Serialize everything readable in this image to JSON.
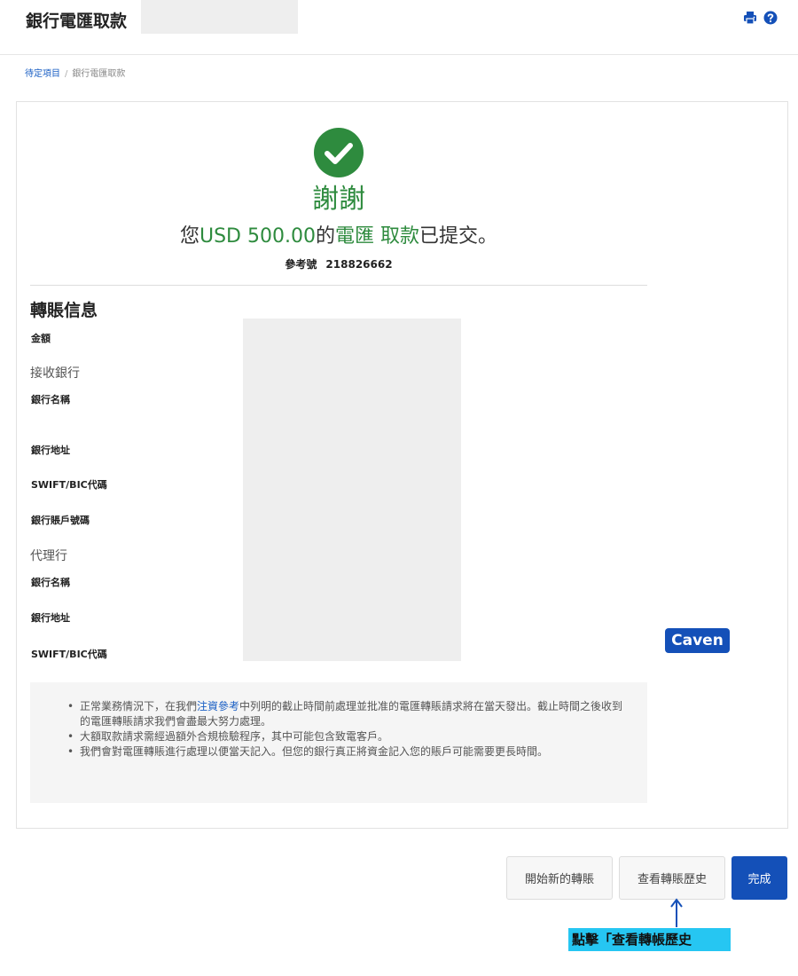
{
  "header": {
    "title": "銀行電匯取款",
    "print_icon": "print-icon",
    "help_icon": "help-icon"
  },
  "breadcrumb": {
    "parent": "待定項目",
    "separator": "/",
    "current": "銀行電匯取款"
  },
  "confirmation": {
    "icon": "checkmark-circle-icon",
    "thanks": "謝謝",
    "prefix": "您",
    "amount": "USD 500.00",
    "middle": "的",
    "type1": "電匯",
    "type2": "取款",
    "suffix": "已提交。",
    "ref_label": "參考號",
    "ref_number": "218826662"
  },
  "transfer_info": {
    "title": "轉賬信息",
    "amount_label": "金額",
    "receiving_bank_heading": "接收銀行",
    "bank_name_label": "銀行名稱",
    "bank_address_label": "銀行地址",
    "swift_label": "SWIFT/BIC代碼",
    "account_label": "銀行賬戶號碼",
    "intermediary_heading": "代理行",
    "int_bank_name_label": "銀行名稱",
    "int_bank_address_label": "銀行地址",
    "int_swift_label": "SWIFT/BIC代碼"
  },
  "notes": {
    "n1_pre": "正常業務情況下，在我們",
    "n1_link": "注資參考",
    "n1_post": "中列明的截止時間前處理並批准的電匯轉賬請求將在當天發出。截止時間之後收到的電匯轉賬請求我們會盡最大努力處理。",
    "n2": "大額取款請求需經過額外合規檢驗程序，其中可能包含致電客戶。",
    "n3": "我們會對電匯轉賬進行處理以便當天記入。但您的銀行真正將資金記入您的賬戶可能需要更長時間。"
  },
  "annotation": {
    "name_badge": "Caven",
    "callout": "點擊「查看轉帳歷史"
  },
  "buttons": {
    "new_transfer": "開始新的轉賬",
    "view_history": "查看轉賬歷史",
    "done": "完成"
  },
  "colors": {
    "success_green": "#2e8b3e",
    "brand_blue": "#1450b8",
    "link_blue": "#1a5fc4",
    "callout_cyan": "#26c6f2"
  }
}
